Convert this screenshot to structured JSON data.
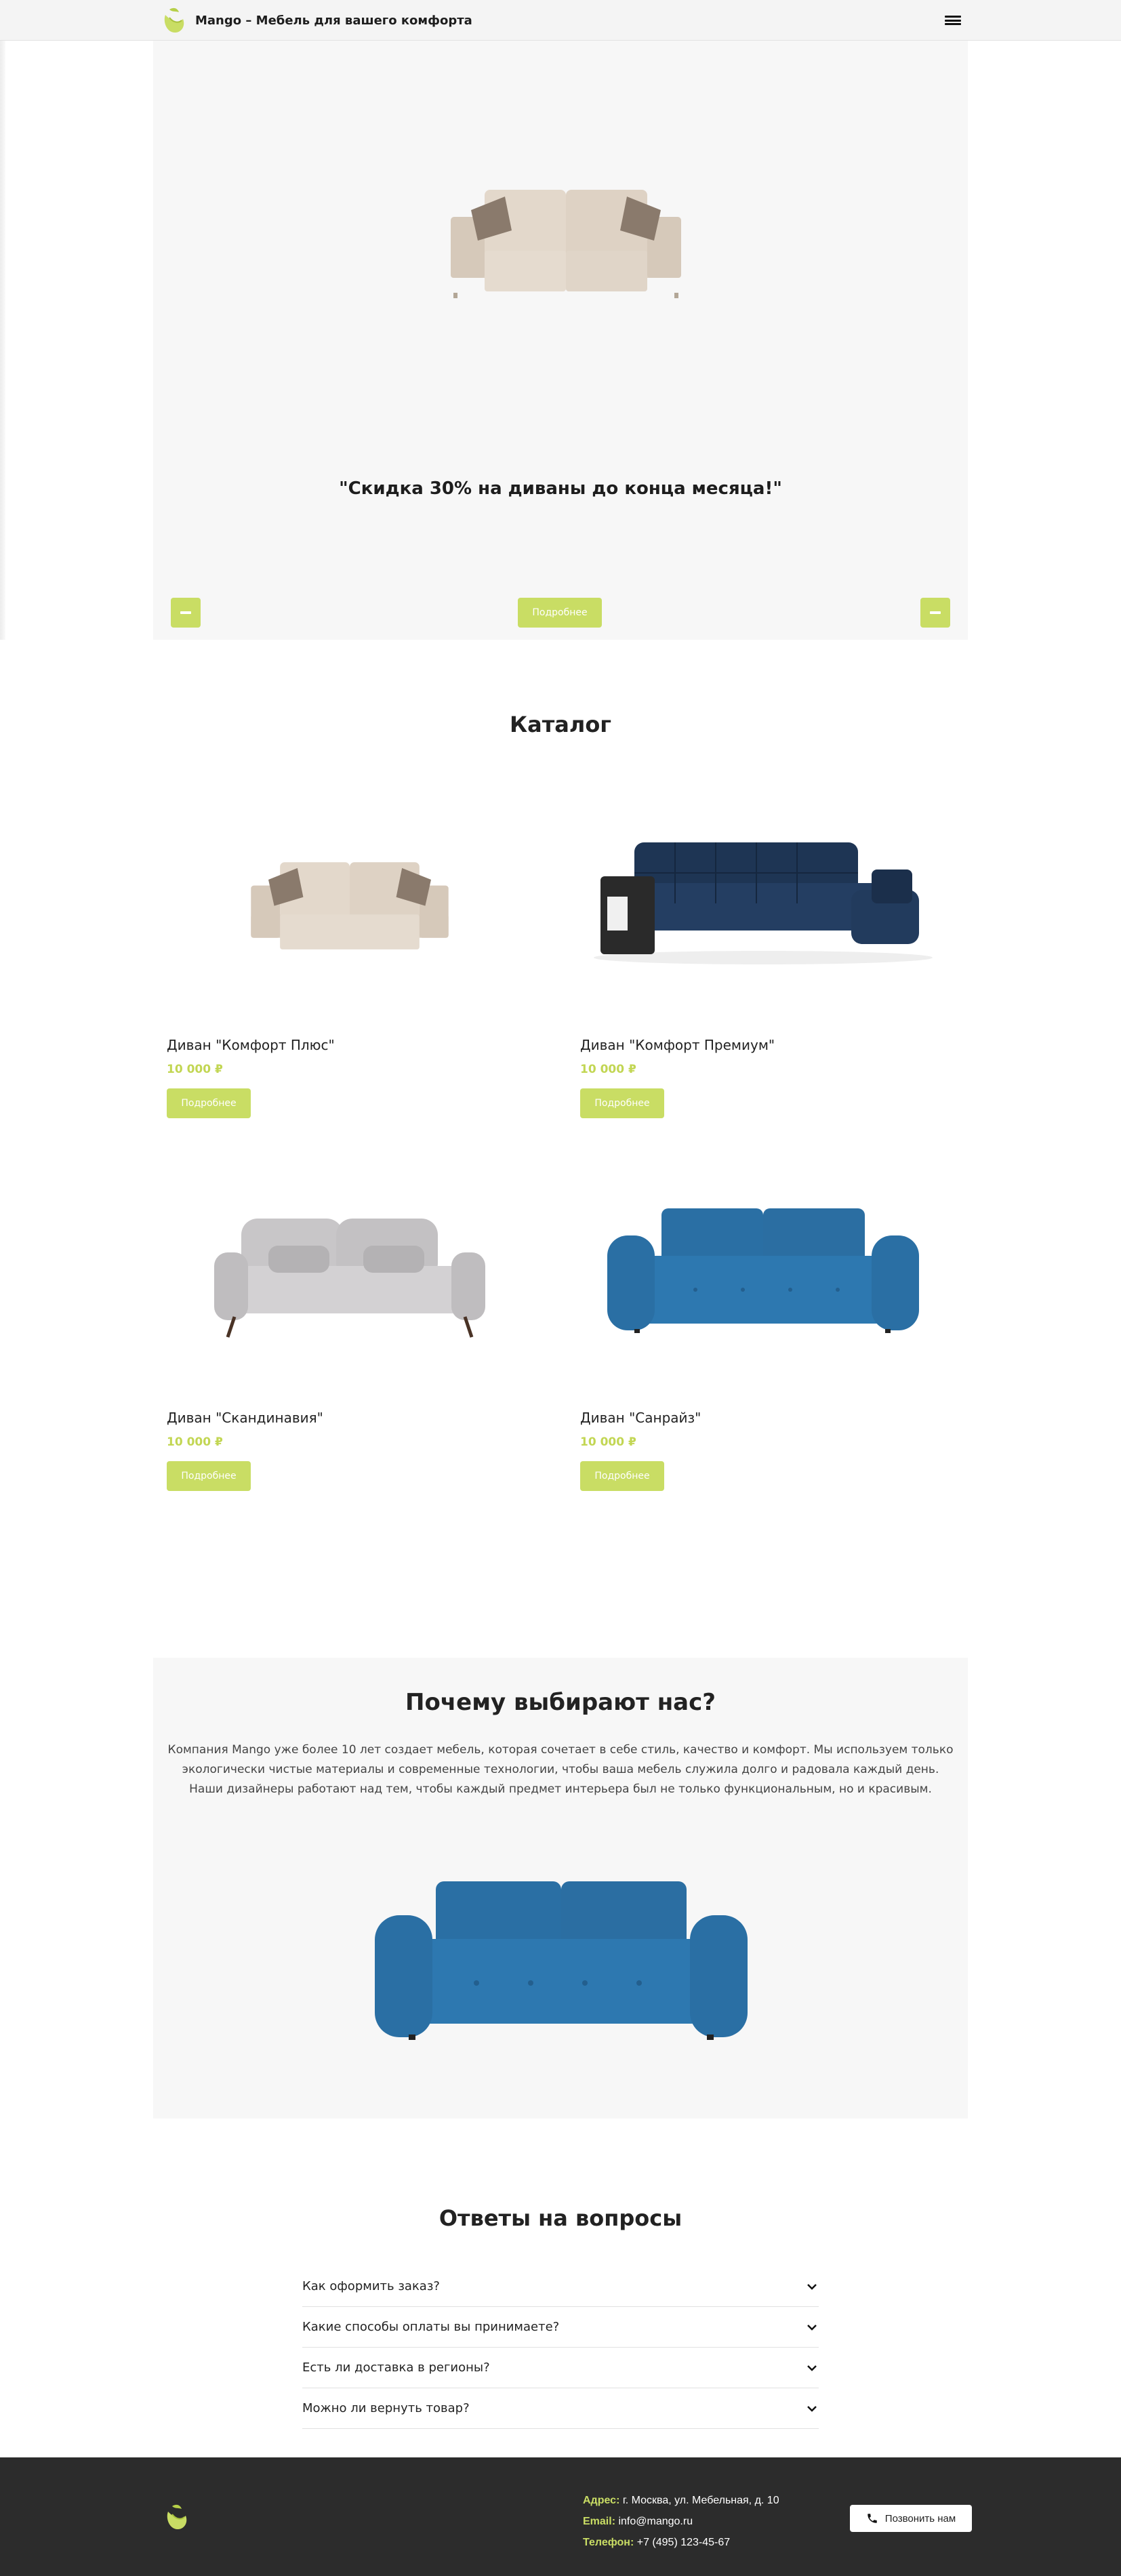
{
  "header": {
    "brand_title": "Mango – Мебель для вашего комфорта",
    "logo_icon": "mango-leaf-logo-icon",
    "menu_icon": "hamburger-menu-icon"
  },
  "hero": {
    "promo_text": "\"Скидка 30% на диваны до конца месяца!\"",
    "more_label": "Подробнее",
    "prev_icon": "arrow-prev-icon",
    "next_icon": "arrow-next-icon"
  },
  "catalog": {
    "title": "Каталог",
    "items": [
      {
        "name": "Диван \"Комфорт Плюс\"",
        "price": "10 000 ₽",
        "button": "Подробнее"
      },
      {
        "name": "Диван \"Комфорт Премиум\"",
        "price": "10 000 ₽",
        "button": "Подробнее"
      },
      {
        "name": "Диван \"Скандинавия\"",
        "price": "10 000 ₽",
        "button": "Подробнее"
      },
      {
        "name": "Диван \"Санрайз\"",
        "price": "10 000 ₽",
        "button": "Подробнее"
      }
    ]
  },
  "why": {
    "title": "Почему выбирают нас?",
    "text": "Компания Mango уже более 10 лет создает мебель, которая сочетает в себе стиль, качество и комфорт. Мы используем только экологически чистые материалы и современные технологии, чтобы ваша мебель служила долго и радовала каждый день. Наши дизайнеры работают над тем, чтобы каждый предмет интерьера был не только функциональным, но и красивым."
  },
  "faq": {
    "title": "Ответы на вопросы",
    "items": [
      {
        "question": "Как оформить заказ?"
      },
      {
        "question": "Какие способы оплаты вы принимаете?"
      },
      {
        "question": "Есть ли доставка в регионы?"
      },
      {
        "question": "Можно ли вернуть товар?"
      }
    ]
  },
  "footer": {
    "address_label": "Адрес:",
    "address": "г. Москва, ул. Мебельная, д. 10",
    "email_label": "Email:",
    "email": "info@mango.ru",
    "phone_label": "Телефон:",
    "phone": "+7 (495) 123-45-67",
    "call_button": "Позвонить нам"
  },
  "colors": {
    "accent": "#c9dd64",
    "footer_bg": "#2c2c2c",
    "section_bg": "#f7f7f7"
  }
}
